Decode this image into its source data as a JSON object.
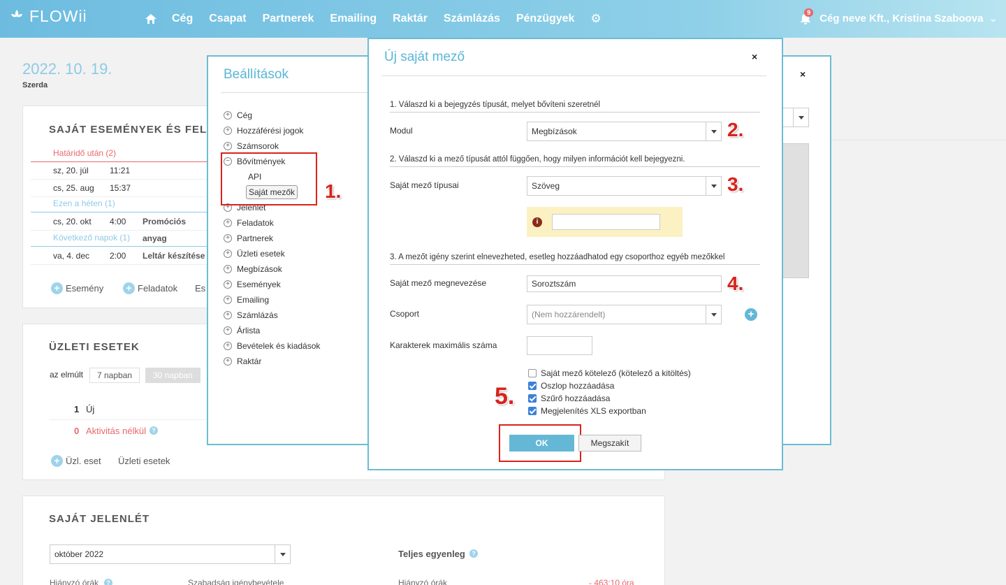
{
  "topbar": {
    "logo": "FLOWii",
    "nav": [
      "Cég",
      "Csapat",
      "Partnerek",
      "Emailing",
      "Raktár",
      "Számlázás",
      "Pénzügyek"
    ],
    "notification_count": "9",
    "user": "Cég neve Kft., Kristina Szaboova"
  },
  "dashboard": {
    "date": "2022. 10. 19.",
    "day": "Szerda",
    "events_title": "SAJÁT ESEMÉNYEK ÉS FELA",
    "groups": [
      {
        "label": "Határidő után (2)",
        "color": "#e8686c"
      },
      {
        "label": "Ezen a héten (1)",
        "color": "#8ecae6"
      },
      {
        "label": "Következő napok (1)",
        "color": "#8ecae6"
      }
    ],
    "rows": [
      {
        "date": "sz, 20. júl",
        "time": "11:21",
        "title": ""
      },
      {
        "date": "cs, 25. aug",
        "time": "15:37",
        "title": ""
      },
      {
        "date": "cs, 20. okt",
        "time": "4:00",
        "title": "Promóciós anyag"
      },
      {
        "date": "va, 4. dec",
        "time": "2:00",
        "title": "Leltár készítése"
      }
    ],
    "event_links": [
      "Esemény",
      "Feladatok",
      "Es"
    ],
    "business_title": "ÜZLETI ESETEK",
    "range_label": "az elmúlt",
    "range_7": "7 napban",
    "range_30": "30 napban",
    "stat_new_count": "1",
    "stat_new_label": "Új",
    "stat_inactive_count": "0",
    "stat_inactive_label": "Aktivitás nélkül",
    "business_add": "Üzl. eset",
    "business_link": "Üzleti esetek",
    "attendance_title": "SAJÁT JELENLÉT",
    "month_select": "október 2022",
    "balance_label": "Teljes egyenleg",
    "missing_hours": "Hiányzó órák",
    "vacation": "Szabadság igénybevétele",
    "missing_hours_2": "Hiányzó órák",
    "missing_value": "- 463:10 óra"
  },
  "settings": {
    "title": "Beállítások",
    "tree": [
      {
        "label": "Cég",
        "toggle": "+"
      },
      {
        "label": "Hozzáférési jogok",
        "toggle": "+"
      },
      {
        "label": "Számsorok",
        "toggle": "+"
      },
      {
        "label": "Bővítmények",
        "toggle": "−"
      }
    ],
    "subitems": [
      "API",
      "Saját mezők"
    ],
    "tree_rest": [
      "Jelenlét",
      "Feladatok",
      "Partnerek",
      "Üzleti esetek",
      "Megbízások",
      "Események",
      "Emailing",
      "Számlázás",
      "Árlista",
      "Bevételek és kiadások",
      "Raktár"
    ]
  },
  "new_field": {
    "title": "Új saját mező",
    "step1": "1. Válaszd ki a bejegyzés típusát, melyet bővíteni szeretnél",
    "module_label": "Modul",
    "module_value": "Megbízások",
    "step2": "2. Válaszd ki a mező típusát attól függően, hogy milyen információt kell bejegyezni.",
    "type_label": "Saját mező típusai",
    "type_value": "Szöveg",
    "step3": "3. A mezőt igény szerint elnevezheted, esetleg hozzáadhatod egy csoporthoz egyéb mezőkkel",
    "name_label": "Saját mező megnevezése",
    "name_value": "Soroztszám",
    "group_label": "Csoport",
    "group_value": "(Nem hozzárendelt)",
    "maxchars_label": "Karakterek maximális száma",
    "checkboxes": [
      {
        "label": "Saját mező kötelező (kötelező a kitöltés)",
        "checked": false
      },
      {
        "label": "Oszlop hozzáadása",
        "checked": true
      },
      {
        "label": "Szűrő hozzáadása",
        "checked": true
      },
      {
        "label": "Megjelenítés XLS exportban",
        "checked": true
      }
    ],
    "ok": "OK",
    "cancel": "Megszakít"
  },
  "annotations": [
    "1.",
    "2.",
    "3.",
    "4.",
    "5."
  ],
  "colors": {
    "accent": "#5ab6d6",
    "annotation": "#d8231c"
  }
}
